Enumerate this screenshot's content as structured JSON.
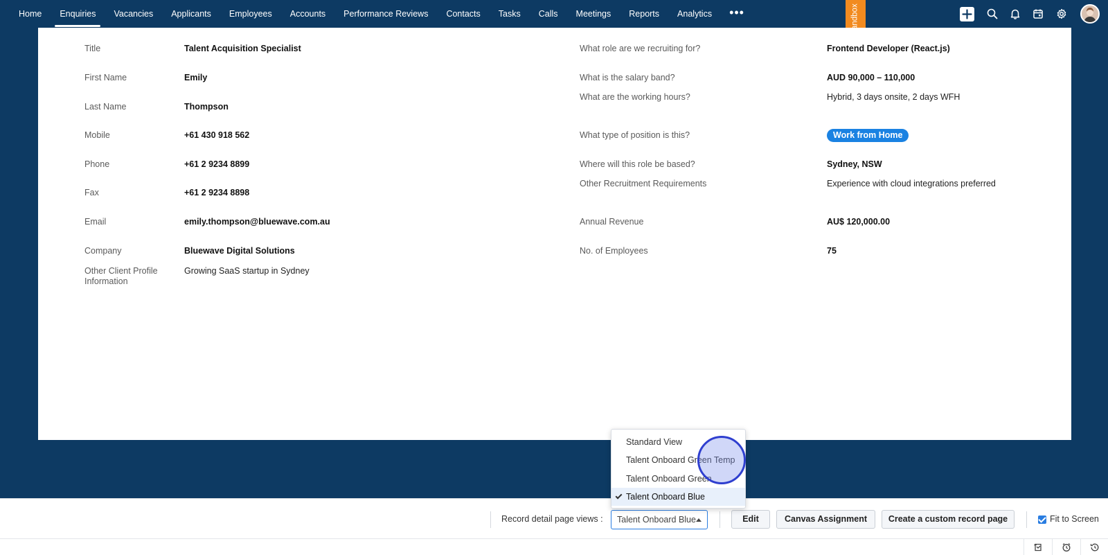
{
  "nav": {
    "tabs": [
      "Home",
      "Enquiries",
      "Vacancies",
      "Applicants",
      "Employees",
      "Accounts",
      "Performance Reviews",
      "Contacts",
      "Tasks",
      "Calls",
      "Meetings",
      "Reports",
      "Analytics"
    ],
    "active_tab": "Enquiries",
    "more_label": "•••",
    "sandbox_label": "Sandbox",
    "icons": [
      "create-new-icon",
      "search-icon",
      "bell-icon",
      "calendar-icon",
      "gear-icon",
      "avatar"
    ]
  },
  "left_fields": [
    {
      "label": "Title",
      "value": "Talent Acquisition Specialist"
    },
    {
      "label": "First Name",
      "value": "Emily"
    },
    {
      "label": "Last Name",
      "value": "Thompson"
    },
    {
      "label": "Mobile",
      "value": "+61 430 918 562"
    },
    {
      "label": "Phone",
      "value": "+61 2 9234 8899"
    },
    {
      "label": "Fax",
      "value": "+61 2 9234 8898"
    },
    {
      "label": "Email",
      "value": "emily.thompson@bluewave.com.au"
    },
    {
      "label": "Company",
      "value": "Bluewave Digital Solutions"
    },
    {
      "label": "Other Client Profile Information",
      "value": "Growing SaaS startup in Sydney"
    }
  ],
  "right_fields": [
    {
      "label": "What role are we recruiting for?",
      "value": "Frontend Developer (React.js)"
    },
    {
      "label": "What is the salary band?",
      "value": "AUD 90,000 – 110,000"
    },
    {
      "label": "What are the working hours?",
      "value": "Hybrid, 3 days onsite, 2 days WFH"
    },
    {
      "label": "What type of position is this?",
      "value": "Work from Home"
    },
    {
      "label": "Where will this role be based?",
      "value": "Sydney, NSW"
    },
    {
      "label": "Other Recruitment Requirements",
      "value": "Experience with cloud integrations preferred"
    },
    {
      "label": "Annual Revenue",
      "value": "AU$ 120,000.00"
    },
    {
      "label": "No. of Employees",
      "value": "75"
    }
  ],
  "bottom_bar": {
    "views_label": "Record detail page views :",
    "selected_view": "Talent Onboard Blue",
    "edit_label": "Edit",
    "canvas_label": "Canvas Assignment",
    "custom_page_label": "Create a custom record page",
    "fit_label": "Fit to Screen",
    "fit_checked": true
  },
  "dropdown": {
    "options": [
      "Standard View",
      "Talent Onboard Green Temp",
      "Talent Onboard Green",
      "Talent Onboard Blue"
    ],
    "selected": "Talent Onboard Blue"
  },
  "strip_icons": [
    "history-icon",
    "alarm-icon",
    "recent-activity-icon"
  ],
  "colors": {
    "nav_bg": "#0d3a63",
    "sandbox": "#f28b20",
    "accent": "#2a7de1",
    "pill": "#1a82e2"
  }
}
